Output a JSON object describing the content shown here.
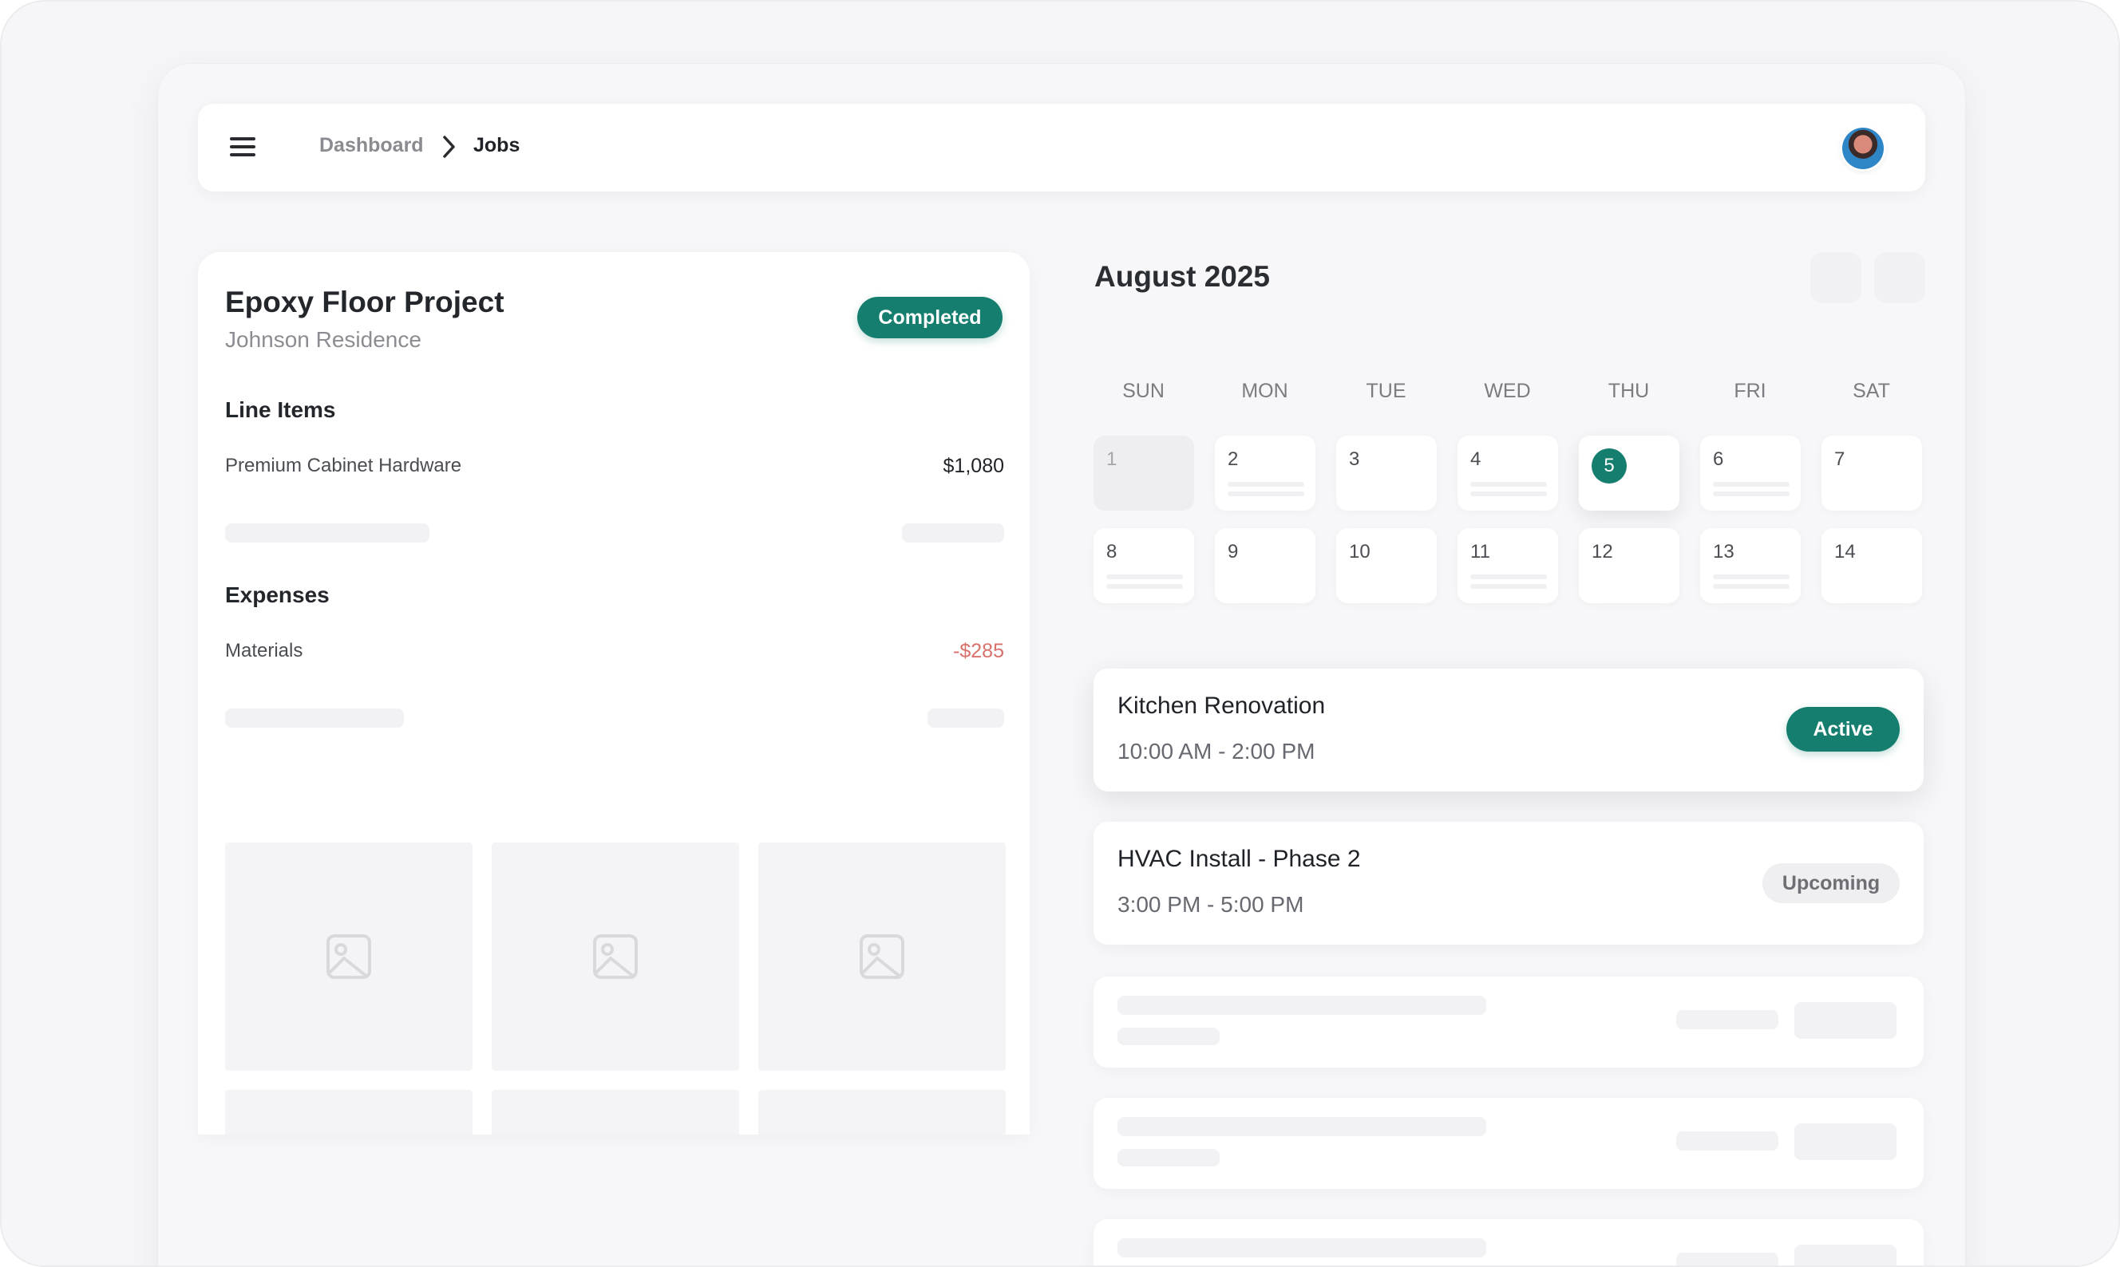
{
  "breadcrumb": {
    "parent": "Dashboard",
    "current": "Jobs"
  },
  "project": {
    "title": "Epoxy Floor Project",
    "client": "Johnson Residence",
    "status": "Completed",
    "line_items_title": "Line Items",
    "line_items": [
      {
        "label": "Premium Cabinet Hardware",
        "value": "$1,080"
      }
    ],
    "expenses_title": "Expenses",
    "expenses": [
      {
        "label": "Materials",
        "value": "-$285"
      }
    ]
  },
  "calendar": {
    "month": "August 2025",
    "weekdays": [
      "SUN",
      "MON",
      "TUE",
      "WED",
      "THU",
      "FRI",
      "SAT"
    ],
    "days": [
      "1",
      "2",
      "3",
      "4",
      "5",
      "6",
      "7",
      "8",
      "9",
      "10",
      "11",
      "12",
      "13",
      "14"
    ],
    "today": "5"
  },
  "events": [
    {
      "title": "Kitchen Renovation",
      "time": "10:00 AM - 2:00 PM",
      "status": "Active"
    },
    {
      "title": "HVAC Install - Phase 2",
      "time": "3:00 PM - 5:00 PM",
      "status": "Upcoming"
    }
  ],
  "colors": {
    "accent": "#167e6e",
    "negative": "#d9716b",
    "background": "#f7f7f9"
  }
}
